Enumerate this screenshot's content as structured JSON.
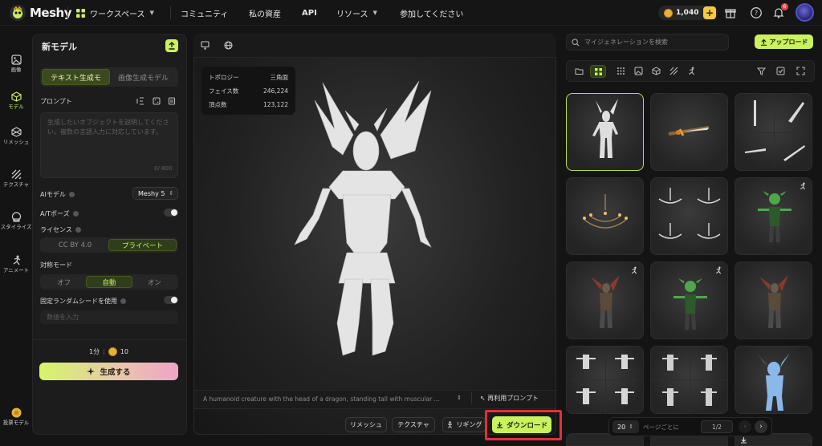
{
  "app": {
    "name": "Meshy"
  },
  "topnav": {
    "workspace": "ワークスペース",
    "community": "コミュニティ",
    "assets": "私の資産",
    "api": "API",
    "resources": "リソース",
    "join": "参加してください",
    "credits": "1,040",
    "notification_count": "6"
  },
  "rail": [
    {
      "label": "画像",
      "icon": "image-icon"
    },
    {
      "label": "モデル",
      "icon": "cube-icon"
    },
    {
      "label": "リメッシュ",
      "icon": "remesh-icon"
    },
    {
      "label": "テクスチャ",
      "icon": "texture-icon"
    },
    {
      "label": "スタイライズ",
      "icon": "stylize-icon"
    },
    {
      "label": "アニメート",
      "icon": "animate-icon"
    },
    {
      "label": "投票モデル",
      "icon": "vote-icon"
    }
  ],
  "panel": {
    "title": "新モデル",
    "tabs": [
      "テキスト生成モ",
      "画像生成モデル"
    ],
    "prompt_label": "プロンプト",
    "prompt_placeholder": "生成したいオブジェクトを説明してください。複数の言語入力に対応しています。",
    "char_count": "0/ 800",
    "ai_model_label": "AIモデル",
    "ai_model_value": "Meshy 5",
    "apose_label": "A/Tポーズ",
    "license_label": "ライセンス",
    "license_options": [
      "CC BY 4.0",
      "プライベート"
    ],
    "symmetry_label": "対称モード",
    "symmetry_options": [
      "オフ",
      "自動",
      "オン"
    ],
    "seed_label": "固定ランダムシードを使用",
    "seed_placeholder": "数値を入力",
    "time_estimate": "1分",
    "cost": "10",
    "generate_label": "生成する"
  },
  "viewport": {
    "stats": [
      {
        "label": "トポロジー",
        "value": "三角面"
      },
      {
        "label": "フェイス数",
        "value": "246,224"
      },
      {
        "label": "頂点数",
        "value": "123,122"
      }
    ],
    "prompt_text": "A humanoid creature with the head of a dragon, standing tall with muscular ...",
    "reuse_label": "再利用プロンプト",
    "buttons": {
      "remesh": "リメッシュ",
      "texture": "テクスチャ",
      "rigging": "リギング",
      "download": "ダウンロード"
    }
  },
  "library": {
    "search_placeholder": "マイジェネレーションを検索",
    "upload_label": "アップロード",
    "per_page_value": "20",
    "per_page_label": "ページごとに",
    "page": "1/2"
  },
  "colors": {
    "accent": "#c9f25d",
    "highlight": "#e2303a",
    "background": "#141414",
    "panel": "#1c1c1c"
  }
}
